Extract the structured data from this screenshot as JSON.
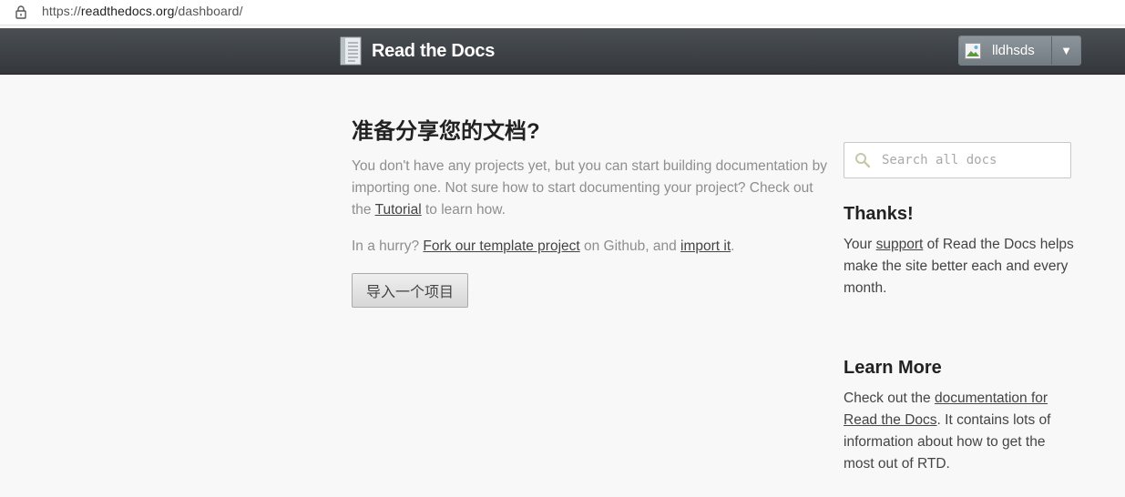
{
  "browser": {
    "url_prefix": "https://",
    "url_host": "readthedocs.org",
    "url_path": "/dashboard/",
    "lock_icon": "lock-icon"
  },
  "header": {
    "brand": "Read the Docs",
    "brand_icon": "book-icon",
    "username": "lldhsds",
    "caret": "▼"
  },
  "main": {
    "title": "准备分享您的文档?",
    "intro_before": "You don't have any projects yet, but you can start building documentation by importing one. Not sure how to start documenting your project? Check out the ",
    "tutorial_link": "Tutorial",
    "intro_after": " to learn how.",
    "hurry_prefix": "In a hurry? ",
    "fork_link": "Fork our template project",
    "hurry_middle": " on Github, and ",
    "import_link": "import it",
    "hurry_suffix": ".",
    "import_button": "导入一个项目"
  },
  "sidebar": {
    "search_placeholder": "Search all docs",
    "thanks_heading": "Thanks!",
    "thanks_prefix": "Your ",
    "support_link": "support",
    "thanks_suffix": " of Read the Docs helps make the site better each and every month.",
    "learn_heading": "Learn More",
    "learn_prefix": "Check out the ",
    "docs_link": "documentation for Read the Docs",
    "learn_suffix": ". It contains lots of information about how to get the most out of RTD."
  }
}
